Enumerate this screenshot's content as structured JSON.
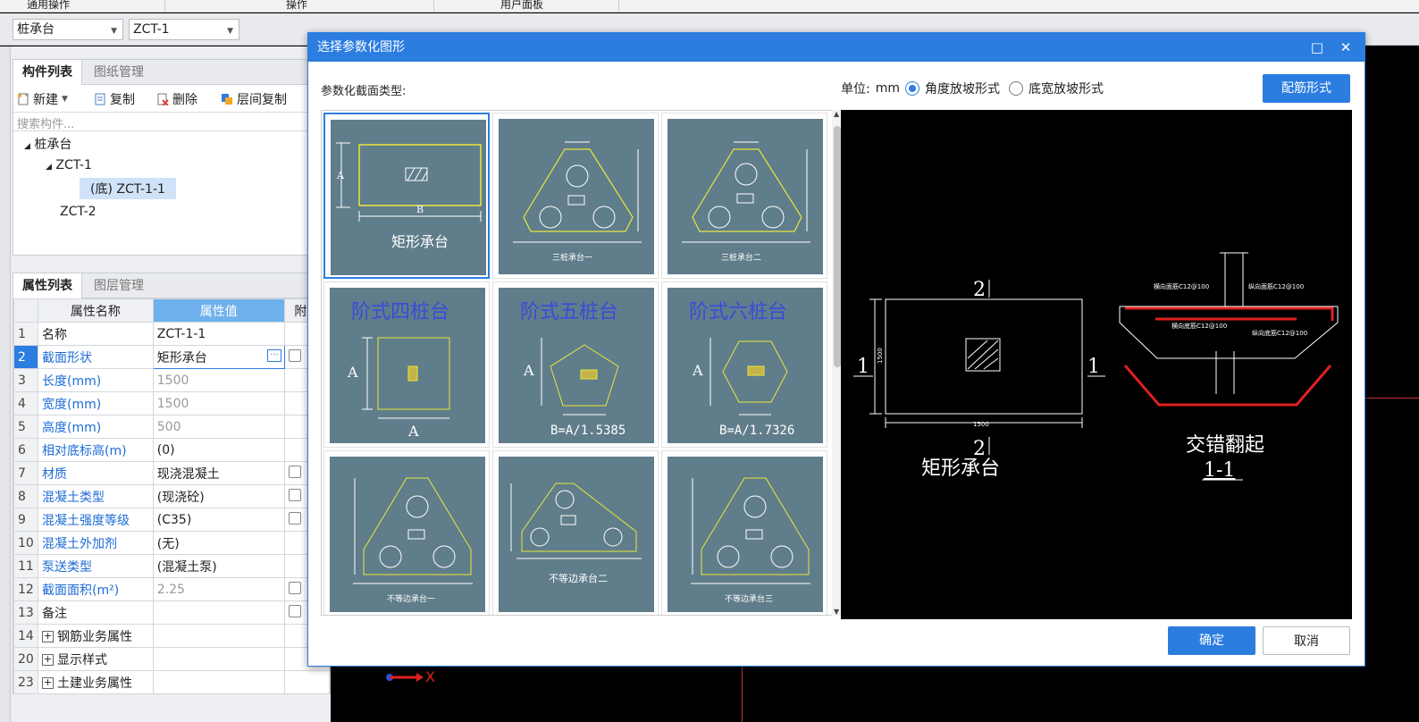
{
  "ribbon": {
    "items": [
      "通用操作",
      "操作",
      "用户面板"
    ]
  },
  "toolbar": {
    "type_select": "桩承台",
    "name_select": "ZCT-1"
  },
  "component_panel": {
    "tabs": [
      "构件列表",
      "图纸管理"
    ],
    "commands": {
      "new": "新建",
      "copy": "复制",
      "delete": "删除",
      "floor_copy": "层间复制"
    },
    "search_placeholder": "搜索构件...",
    "tree": {
      "root": "桩承台",
      "child1": "ZCT-1",
      "leaf": "(底) ZCT-1-1",
      "child2": "ZCT-2"
    }
  },
  "property_panel": {
    "tabs": [
      "属性列表",
      "图层管理"
    ],
    "headers": {
      "name": "属性名称",
      "value": "属性值",
      "extra": "附加"
    },
    "rows": [
      {
        "num": "1",
        "name": "名称",
        "value": "ZCT-1-1"
      },
      {
        "num": "2",
        "name": "截面形状",
        "value": "矩形承台"
      },
      {
        "num": "3",
        "name": "长度(mm)",
        "value": "1500"
      },
      {
        "num": "4",
        "name": "宽度(mm)",
        "value": "1500"
      },
      {
        "num": "5",
        "name": "高度(mm)",
        "value": "500"
      },
      {
        "num": "6",
        "name": "相对底标高(m)",
        "value": "(0)"
      },
      {
        "num": "7",
        "name": "材质",
        "value": "现浇混凝土"
      },
      {
        "num": "8",
        "name": "混凝土类型",
        "value": "(现浇砼)"
      },
      {
        "num": "9",
        "name": "混凝土强度等级",
        "value": "(C35)"
      },
      {
        "num": "10",
        "name": "混凝土外加剂",
        "value": "(无)"
      },
      {
        "num": "11",
        "name": "泵送类型",
        "value": "(混凝土泵)"
      },
      {
        "num": "12",
        "name": "截面面积(m²)",
        "value": "2.25"
      },
      {
        "num": "13",
        "name": "备注",
        "value": ""
      },
      {
        "num": "14",
        "name": "钢筋业务属性",
        "value": ""
      },
      {
        "num": "20",
        "name": "显示样式",
        "value": ""
      },
      {
        "num": "23",
        "name": "土建业务属性",
        "value": ""
      }
    ]
  },
  "canvas": {
    "axis_x": "X"
  },
  "dialog": {
    "title": "选择参数化图形",
    "section_label": "参数化截面类型:",
    "unit_label": "单位:",
    "unit_value": "mm",
    "radio1": "角度放坡形式",
    "radio2": "底宽放坡形式",
    "rebar_button": "配筋形式",
    "ok": "确定",
    "cancel": "取消",
    "shapes": [
      {
        "label": "矩形承台"
      },
      {
        "label": "三桩承台一"
      },
      {
        "label": "三桩承台二"
      },
      {
        "label": "阶式四桩台",
        "formula": ""
      },
      {
        "label": "阶式五桩台",
        "formula": "B=A/1.5385"
      },
      {
        "label": "阶式六桩台",
        "formula": "B=A/1.7326"
      },
      {
        "label": "不等边承台一"
      },
      {
        "label": "不等边承台二"
      },
      {
        "label": "不等边承台三"
      }
    ],
    "dim_letters": {
      "a": "A",
      "b": "B"
    },
    "preview": {
      "plan_title": "矩形承台",
      "section_mark": "1",
      "section_mark2": "2",
      "dim": "1500",
      "section_title": "交错翻起",
      "section_name": "1-1",
      "rebar1": "横向面筋C12@100",
      "rebar2": "纵向面筋C12@100",
      "rebar3": "横向底筋C12@100",
      "rebar4": "纵向底筋C12@100"
    }
  },
  "colors": {
    "accent": "#2b7de0",
    "thumb_bg": "#607d8b",
    "shape_line": "#e8e83a",
    "rebar_red": "#e02020"
  }
}
